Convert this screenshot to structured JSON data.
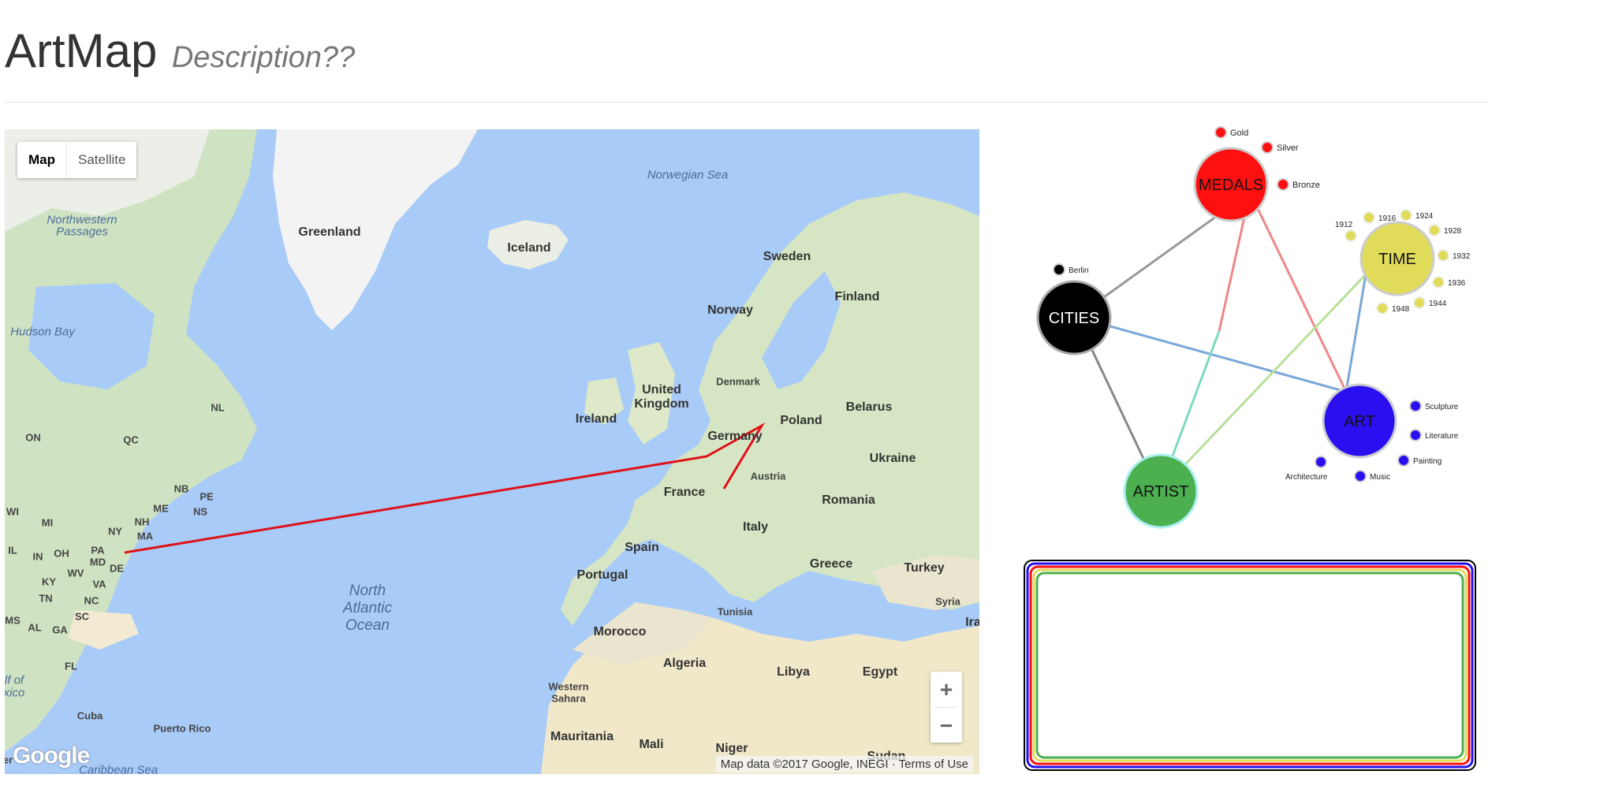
{
  "header": {
    "title": "ArtMap",
    "description": "Description??"
  },
  "map": {
    "type_controls": {
      "map_label": "Map",
      "satellite_label": "Satellite",
      "selected": "Map"
    },
    "zoom": {
      "in_label": "+",
      "out_label": "−"
    },
    "logo": "Google",
    "attribution": {
      "data": "Map data ©2017 Google, INEGI",
      "terms": "Terms of Use"
    },
    "labels": {
      "greenland": "Greenland",
      "iceland": "Iceland",
      "norwegian_sea": "Norwegian Sea",
      "sweden": "Sweden",
      "finland": "Finland",
      "norway": "Norway",
      "united_kingdom_1": "United",
      "united_kingdom_2": "Kingdom",
      "ireland": "Ireland",
      "denmark": "Denmark",
      "germany": "Germany",
      "poland": "Poland",
      "belarus": "Belarus",
      "ukraine": "Ukraine",
      "austria": "Austria",
      "france": "France",
      "romania": "Romania",
      "spain": "Spain",
      "portugal": "Portugal",
      "italy": "Italy",
      "greece": "Greece",
      "turkey": "Turkey",
      "syria": "Syria",
      "ira": "Ira",
      "tunisia": "Tunisia",
      "morocco": "Morocco",
      "algeria": "Algeria",
      "libya": "Libya",
      "egypt": "Egypt",
      "western_sahara_1": "Western",
      "western_sahara_2": "Sahara",
      "mauritania": "Mauritania",
      "mali": "Mali",
      "niger": "Niger",
      "sudan": "Sudan",
      "atlantic_1": "North",
      "atlantic_2": "Atlantic",
      "atlantic_3": "Ocean",
      "northwestern_1": "Northwestern",
      "northwestern_2": "Passages",
      "hudson_bay": "Hudson Bay",
      "on": "ON",
      "qc": "QC",
      "nl": "NL",
      "nb": "NB",
      "pe": "PE",
      "ns": "NS",
      "me": "ME",
      "nh": "NH",
      "ma": "MA",
      "ny": "NY",
      "pa": "PA",
      "oh": "OH",
      "in": "IN",
      "il": "IL",
      "wi": "WI",
      "mi": "MI",
      "md": "MD",
      "de": "DE",
      "wv": "WV",
      "va": "VA",
      "ky": "KY",
      "nc": "NC",
      "tn": "TN",
      "sc": "SC",
      "ms": "MS",
      "al": "AL",
      "ga": "GA",
      "fl": "FL",
      "cuba": "Cuba",
      "puerto_rico": "Puerto Rico",
      "caribbean": "Caribbean Sea",
      "gulf_1": "lf of",
      "gulf_2": "xico",
      "er": "er"
    }
  },
  "graph": {
    "hubs": {
      "medals": "MEDALS",
      "time": "TIME",
      "cities": "CITIES",
      "art": "ART",
      "artist": "ARTIST"
    },
    "satellites": {
      "gold": "Gold",
      "silver": "Silver",
      "bronze": "Bronze",
      "y1912": "1912",
      "y1916": "1916",
      "y1924": "1924",
      "y1928": "1928",
      "y1932": "1932",
      "y1936": "1936",
      "y1944": "1944",
      "y1948": "1948",
      "berlin": "Berlin",
      "sculpture": "Sculpture",
      "literature": "Literature",
      "painting": "Painting",
      "music": "Music",
      "architecture": "Architecture"
    },
    "colors": {
      "medals": "#ff1010",
      "time": "#e0dc5a",
      "cities": "#000000",
      "art": "#2a10f0",
      "artist": "#4caf50"
    }
  },
  "panel": {
    "border_colors": [
      "#000000",
      "#2a10f0",
      "#ff1010",
      "#e0dc5a",
      "#4caf50"
    ]
  }
}
